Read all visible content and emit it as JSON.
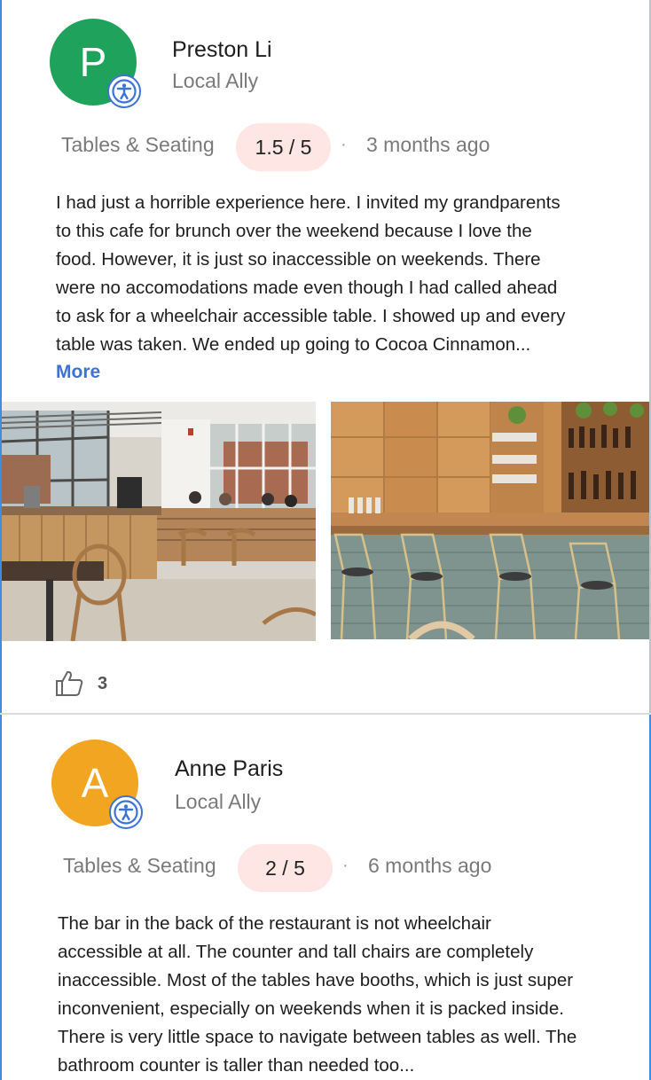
{
  "reviews": [
    {
      "initial": "P",
      "avatar_color": "#1fa35c",
      "name": "Preston Li",
      "role": "Local Ally",
      "category": "Tables & Seating",
      "rating": "1.5 / 5",
      "separator": "·",
      "time": "3 months ago",
      "text_lines": [
        "I had just a horrible experience here. I invited my grandparents",
        "to this cafe for brunch over the weekend because I love the",
        "food. However, it is just so inaccessible on weekends. There",
        "were no accomodations made even though I had called ahead",
        "to ask for a wheelchair accessible table. I showed up and every",
        "table was taken. We ended up going to Cocoa Cinnamon..."
      ],
      "more_label": "More",
      "likes": "3",
      "photos": [
        "cafe-dining-area-photo",
        "cafe-bar-counter-photo"
      ]
    },
    {
      "initial": "A",
      "avatar_color": "#f1a521",
      "name": "Anne Paris",
      "role": "Local Ally",
      "category": "Tables & Seating",
      "rating": "2 / 5",
      "separator": "·",
      "time": "6 months ago",
      "text_lines": [
        "The bar in the back of the restaurant is not wheelchair",
        "accessible at all. The counter and tall chairs are completely",
        "inaccessible. Most of the tables have booths, which is just super",
        "inconvenient, especially on weekends when it is packed inside.",
        "There is very little space to navigate between tables as well. The",
        "bathroom counter is taller than needed too..."
      ]
    }
  ],
  "colors": {
    "accent": "#3d72d6",
    "rating_bg": "#fde6e3",
    "muted_text": "#7a7a7a"
  },
  "icons": {
    "badge": "accessibility-icon",
    "like": "thumbs-up-icon"
  }
}
